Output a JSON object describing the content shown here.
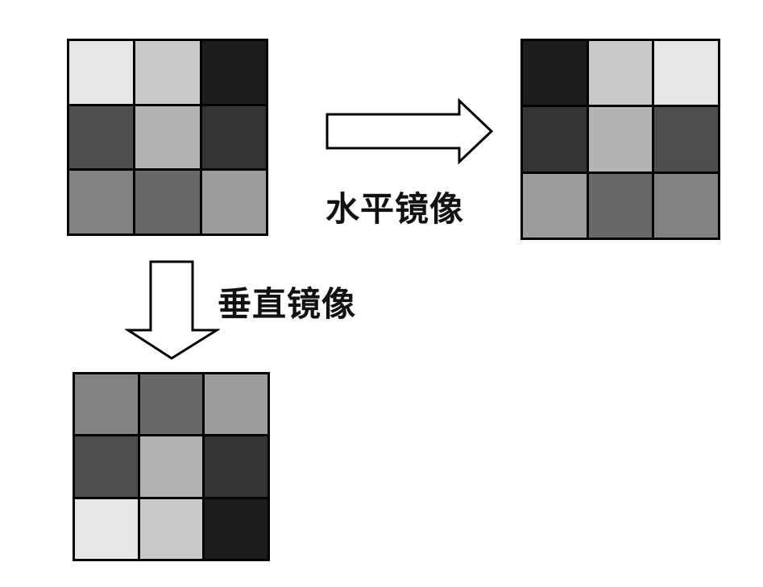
{
  "grids": {
    "original": [
      "#e6e6e6",
      "#c9c9c9",
      "#1c1c1c",
      "#4e4e4e",
      "#b3b3b3",
      "#343434",
      "#828282",
      "#686868",
      "#9c9c9c"
    ],
    "horizontal": [
      "#1c1c1c",
      "#c9c9c9",
      "#e6e6e6",
      "#343434",
      "#b3b3b3",
      "#4e4e4e",
      "#9c9c9c",
      "#686868",
      "#828282"
    ],
    "vertical": [
      "#828282",
      "#686868",
      "#9c9c9c",
      "#4e4e4e",
      "#b3b3b3",
      "#343434",
      "#e6e6e6",
      "#c9c9c9",
      "#1c1c1c"
    ]
  },
  "labels": {
    "horizontal": "水平镜像",
    "vertical": "垂直镜像"
  },
  "arrows": {
    "right_icon": "arrow-right-icon",
    "down_icon": "arrow-down-icon"
  }
}
